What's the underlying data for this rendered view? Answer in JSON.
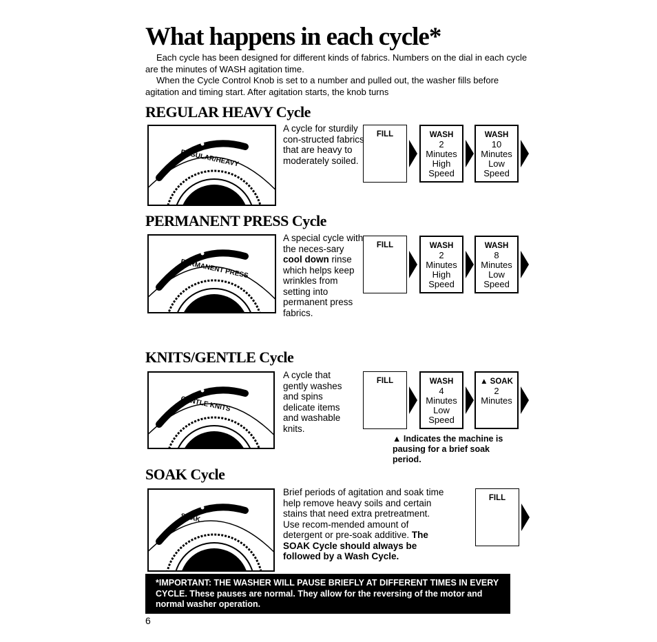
{
  "title": "What happens in each cycle*",
  "intro": [
    "Each cycle has been designed for different kinds of fabrics. Numbers on the dial in each cycle are the minutes of WASH agitation time.",
    "When the Cycle Control Knob is set to a number and pulled out, the washer fills before agitation and timing start. After agitation starts, the knob turns"
  ],
  "sections": [
    {
      "heading": "REGULAR HEAVY Cycle",
      "dial_label": "REGULAR/HEAVY",
      "description": "A cycle for sturdily con-structed fabrics that are heavy to moderately soiled.",
      "steps": [
        {
          "title": "FILL"
        },
        {
          "title": "WASH",
          "lines": [
            "2",
            "Minutes",
            "High",
            "Speed"
          ]
        },
        {
          "title": "WASH",
          "lines": [
            "10",
            "Minutes",
            "Low",
            "Speed"
          ]
        }
      ]
    },
    {
      "heading": "PERMANENT PRESS Cycle",
      "dial_label": "PERMANENT PRESS",
      "description_parts": [
        "A special cycle with the neces-sary ",
        "cool down",
        " rinse which helps keep wrinkles from setting into permanent press fabrics."
      ],
      "steps": [
        {
          "title": "FILL"
        },
        {
          "title": "WASH",
          "lines": [
            "2",
            "Minutes",
            "High",
            "Speed"
          ]
        },
        {
          "title": "WASH",
          "lines": [
            "8",
            "Minutes",
            "Low",
            "Speed"
          ]
        }
      ]
    },
    {
      "heading": "KNITS/GENTLE Cycle",
      "dial_label": "GENTLE KNITS",
      "description": "A cycle that gently washes and spins delicate items and washable knits.",
      "steps": [
        {
          "title": "FILL"
        },
        {
          "title": "WASH",
          "lines": [
            "4",
            "Minutes",
            "Low",
            "Speed"
          ]
        },
        {
          "title": "▲ SOAK",
          "lines": [
            "2",
            "Minutes"
          ]
        }
      ],
      "note": "▲ Indicates the machine is pausing for a brief soak period."
    },
    {
      "heading": "SOAK Cycle",
      "dial_label": "SOAK",
      "description_parts": [
        "Brief periods of agitation and soak time help remove heavy soils and certain stains that need extra pretreatment. Use recom-mended amount of detergent or pre-soak additive. ",
        "The SOAK Cycle should always be followed by a Wash Cycle."
      ],
      "steps": [
        {
          "title": "FILL"
        }
      ]
    }
  ],
  "important": "*IMPORTANT: THE WASHER WILL PAUSE BRIEFLY AT DIFFERENT TIMES IN EVERY CYCLE. These pauses are normal. They allow for the reversing of the motor and normal washer operation.",
  "page_number": "6"
}
